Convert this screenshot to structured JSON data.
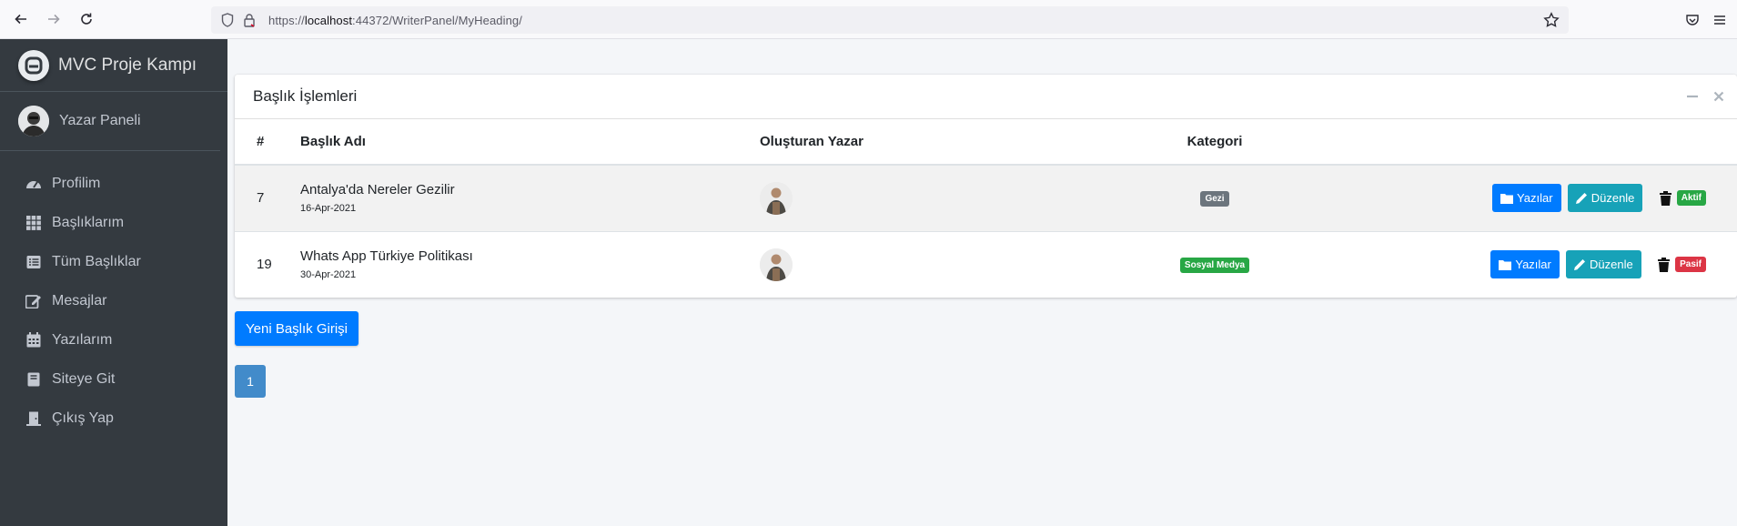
{
  "browser": {
    "url_prefix": "https://",
    "url_host": "localhost",
    "url_rest": ":44372/WriterPanel/MyHeading/"
  },
  "sidebar": {
    "brand": "MVC Proje Kampı",
    "user": "Yazar Paneli",
    "items": [
      {
        "label": "Profilim",
        "icon": "gauge-icon"
      },
      {
        "label": "Başlıklarım",
        "icon": "grid-icon"
      },
      {
        "label": "Tüm Başlıklar",
        "icon": "list-icon"
      },
      {
        "label": "Mesajlar",
        "icon": "edit-icon"
      },
      {
        "label": "Yazılarım",
        "icon": "calendar-icon"
      },
      {
        "label": "Siteye Git",
        "icon": "book-icon"
      },
      {
        "label": "Çıkış Yap",
        "icon": "door-icon"
      }
    ]
  },
  "card": {
    "title": "Başlık İşlemleri",
    "columns": [
      "#",
      "Başlık Adı",
      "Oluşturan Yazar",
      "Kategori"
    ],
    "rows": [
      {
        "id": "7",
        "title": "Antalya'da Nereler Gezilir",
        "date": "16-Apr-2021",
        "category": "Gezi",
        "category_color": "#6c757d",
        "status": "Aktif",
        "status_color": "#28a745"
      },
      {
        "id": "19",
        "title": "Whats App Türkiye Politikası",
        "date": "30-Apr-2021",
        "category": "Sosyal Medya",
        "category_color": "#28a745",
        "status": "Pasif",
        "status_color": "#dc3545"
      }
    ],
    "btn_posts": "Yazılar",
    "btn_edit": "Düzenle"
  },
  "new_button": "Yeni Başlık Girişi",
  "pagination": {
    "current": "1"
  }
}
